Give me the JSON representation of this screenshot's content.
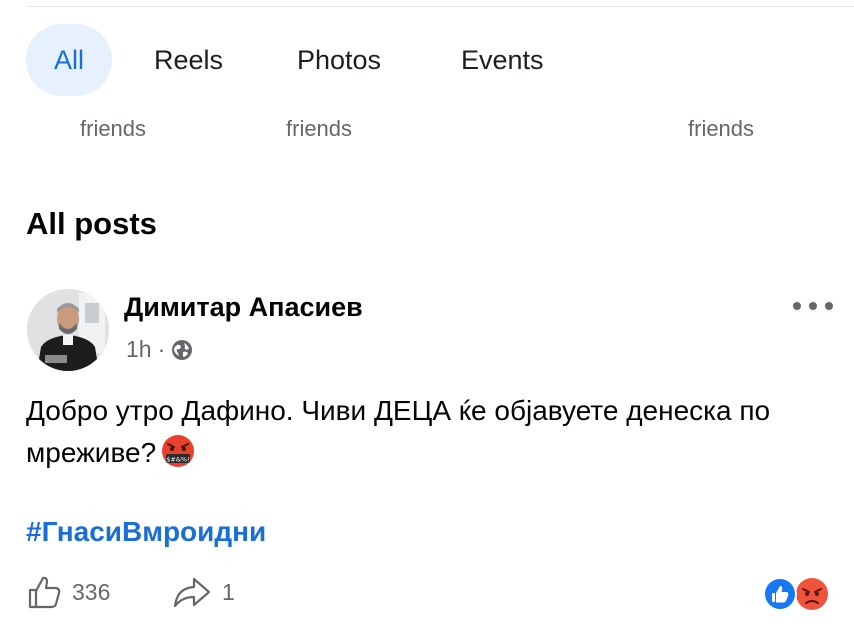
{
  "tabs": [
    {
      "label": "All",
      "active": true
    },
    {
      "label": "Reels",
      "active": false
    },
    {
      "label": "Photos",
      "active": false
    },
    {
      "label": "Events",
      "active": false
    }
  ],
  "friends_labels": [
    "friends",
    "friends",
    "friends"
  ],
  "section": {
    "title": "All posts"
  },
  "post": {
    "author": "Димитар Апасиев",
    "time": "1h",
    "separator": "·",
    "privacy_icon": "globe-icon",
    "text": "Добро утро Дафино. Чиви ДЕЦА ќе објавуете денеска по мреживе?",
    "emoji": "face-with-symbols-on-mouth",
    "hashtag": "#ГнасиВмроидни",
    "likes_count": "336",
    "shares_count": "1",
    "reaction_icons": [
      "like-reaction-icon",
      "angry-reaction-icon"
    ]
  },
  "colors": {
    "accent": "#1a6ed8",
    "active_tab_bg": "#e7f0fd",
    "secondary_text": "#65676b"
  }
}
